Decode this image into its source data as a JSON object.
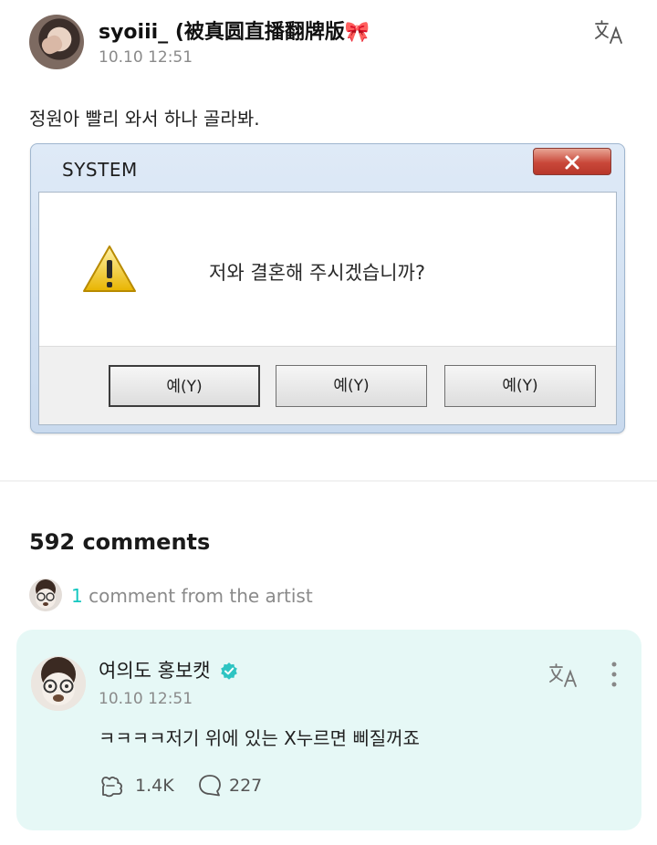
{
  "post": {
    "username": "syoiii_ (被真圆直播翻牌版🎀",
    "time": "10.10 12:51",
    "text": "정원아 빨리 와서 하나 골라봐."
  },
  "dialog": {
    "title": "SYSTEM",
    "close_label": "x",
    "message": "저와 결혼해 주시겠습니까?",
    "buttons": [
      "예(Y)",
      "예(Y)",
      "예(Y)"
    ]
  },
  "comments": {
    "count_label": "592 comments",
    "artist_count": "1",
    "artist_label": " comment from the artist"
  },
  "artist_comment": {
    "name": "여의도 홍보캣",
    "time": "10.10 12:51",
    "text": "ㅋㅋㅋㅋ저기 위에 있는 X누르면 삐질꺼죠",
    "likes": "1.4K",
    "replies": "227"
  },
  "colors": {
    "accent": "#13c7c0",
    "artist_card_bg": "#e6f8f6",
    "verified": "#2ec4c2"
  },
  "icons": [
    "translate-icon",
    "warning-icon",
    "verified-icon",
    "more-icon",
    "like-icon",
    "reply-icon"
  ]
}
